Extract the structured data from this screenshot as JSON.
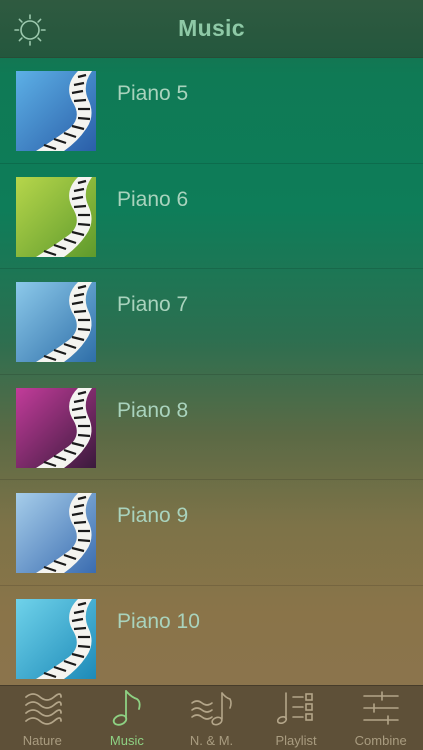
{
  "header": {
    "title": "Music",
    "settings_icon": "sun-gear-icon"
  },
  "tracks": [
    {
      "title": "Piano 5",
      "art_color": "#2a5ea8",
      "art_accent": "#5db0e6"
    },
    {
      "title": "Piano 6",
      "art_color": "#5e9a2c",
      "art_accent": "#b6d64b"
    },
    {
      "title": "Piano 7",
      "art_color": "#2e6ea8",
      "art_accent": "#8cc9ea"
    },
    {
      "title": "Piano 8",
      "art_color": "#3a1a3c",
      "art_accent": "#c23c9a"
    },
    {
      "title": "Piano 9",
      "art_color": "#3a6cb0",
      "art_accent": "#a6cdea"
    },
    {
      "title": "Piano 10",
      "art_color": "#1d8ab8",
      "art_accent": "#6fd2ea"
    }
  ],
  "tabbar": {
    "active": "Music",
    "active_color": "#8ed183",
    "items": [
      {
        "label": "Nature",
        "icon": "waves-icon"
      },
      {
        "label": "Music",
        "icon": "music-note-icon"
      },
      {
        "label": "N. & M.",
        "icon": "waves-note-icon"
      },
      {
        "label": "Playlist",
        "icon": "playlist-icon"
      },
      {
        "label": "Combine",
        "icon": "sliders-icon"
      }
    ]
  }
}
